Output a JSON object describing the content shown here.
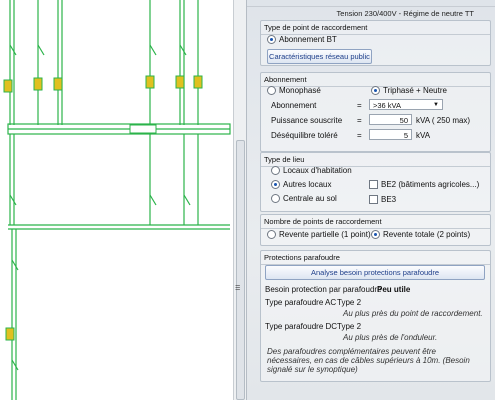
{
  "header": {
    "tension": "Tension 230/400V - Régime de neutre TT"
  },
  "raccordement": {
    "title": "Type de point de raccordement",
    "option": "Abonnement BT",
    "button": "Caractéristiques réseau public"
  },
  "abonnement": {
    "title": "Abonnement",
    "mono": "Monophasé",
    "tri": "Triphasé + Neutre",
    "rows": {
      "abonnement_label": "Abonnement",
      "abonnement_value": ">36 kVA",
      "puissance_label": "Puissance souscrite",
      "puissance_value": "50",
      "puissance_unit": "kVA ( 250 max)",
      "desequilibre_label": "Déséquilibre toléré",
      "desequilibre_value": "5",
      "desequilibre_unit": "kVA"
    },
    "eq": "="
  },
  "lieu": {
    "title": "Type de lieu",
    "options": [
      "Locaux d'habitation",
      "Autres locaux",
      "Centrale au sol"
    ],
    "be2": "BE2 (bâtiments agricoles...)",
    "be3": "BE3"
  },
  "points": {
    "title": "Nombre de points de raccordement",
    "partielle": "Revente partielle (1 point)",
    "totale": "Revente totale (2 points)"
  },
  "parafoudre": {
    "title": "Protections parafoudre",
    "button": "Analyse besoin protections parafoudre",
    "besoin_label": "Besoin protection  par parafoudre",
    "besoin_value": "Peu utile",
    "ac_label": "Type parafoudre AC",
    "ac_value": "Type 2",
    "ac_note": "Au plus près du point de raccordement.",
    "dc_label": "Type parafoudre DC",
    "dc_value": "Type 2",
    "dc_note": "Au plus près de l'onduleur.",
    "note": "Des parafoudres complémentaires peuvent être nécessaires, en cas de câbles supérieurs à 10m. (Besoin signalé sur le synoptique)"
  },
  "colors": {
    "wire": "#2bb34a",
    "accent": "#1a55b0",
    "surge": "#e0c020"
  }
}
